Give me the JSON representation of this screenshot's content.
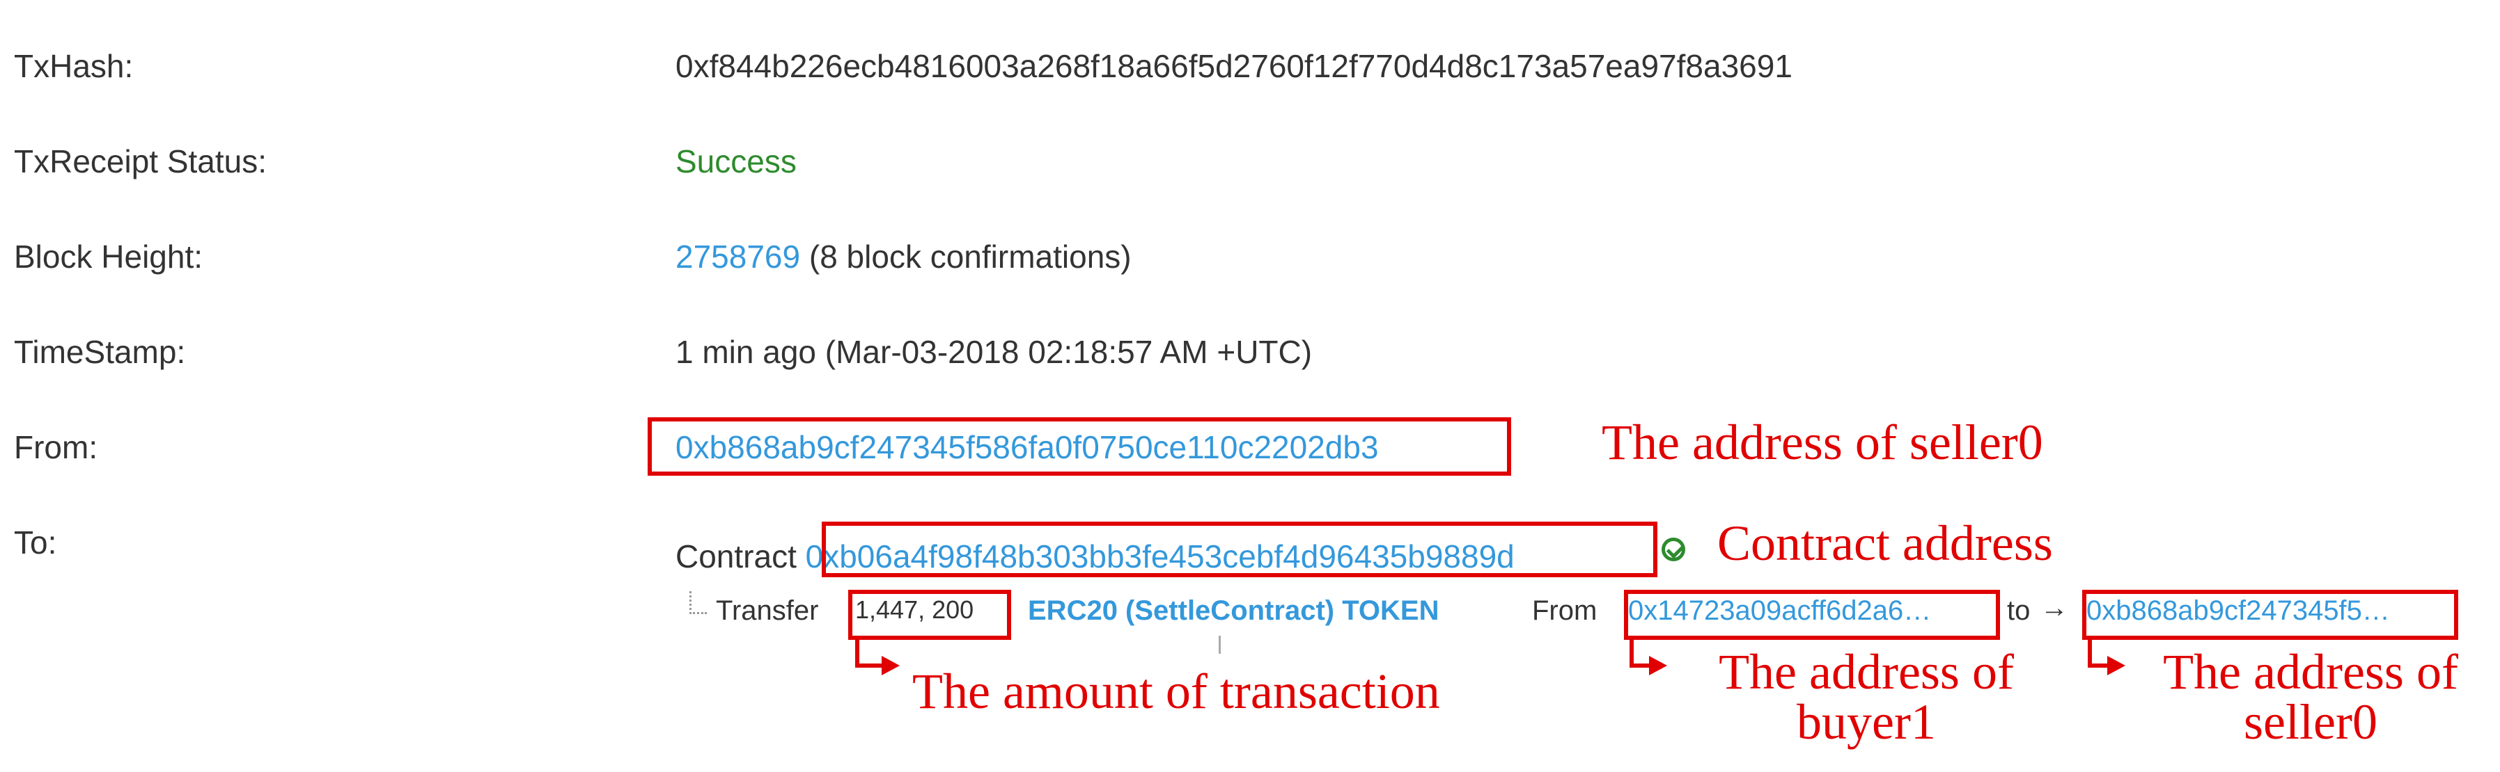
{
  "fields": {
    "txhash": {
      "label": "TxHash:",
      "value": "0xf844b226ecb4816003a268f18a66f5d2760f12f770d4d8c173a57ea97f8a3691"
    },
    "status": {
      "label": "TxReceipt Status:",
      "value": "Success"
    },
    "block": {
      "label": "Block Height:",
      "height": "2758769",
      "confirmations": " (8 block confirmations)"
    },
    "timestamp": {
      "label": "TimeStamp:",
      "value": "1 min ago (Mar-03-2018 02:18:57 AM +UTC)"
    },
    "from": {
      "label": "From:",
      "address": "0xb868ab9cf247345f586fa0f0750ce110c2202db3"
    },
    "to": {
      "label": "To:",
      "contract_prefix": "Contract ",
      "contract_address": "0xb06a4f98f48b303bb3fe453cebf4d96435b9889d",
      "status_icon": "check-circle-icon"
    },
    "transfer": {
      "prefix": "Transfer",
      "amount": "1,447, 200",
      "token": "ERC20 (SettleContract) TOKEN",
      "from_label": "From",
      "from_address": "0x14723a09acff6d2a6…",
      "to_label": "to",
      "arrow": "→",
      "to_address": "0xb868ab9cf247345f5…"
    }
  },
  "annotations": {
    "seller0": "The address of seller0",
    "contract": "Contract address",
    "amount": "The amount of transaction",
    "buyer1_line1": "The address of",
    "buyer1_line2": "buyer1",
    "seller0_line1": "The address of",
    "seller0_line2": "seller0"
  },
  "colors": {
    "annotation": "#e00000",
    "link": "#3498db",
    "success": "#2e8b2e"
  }
}
